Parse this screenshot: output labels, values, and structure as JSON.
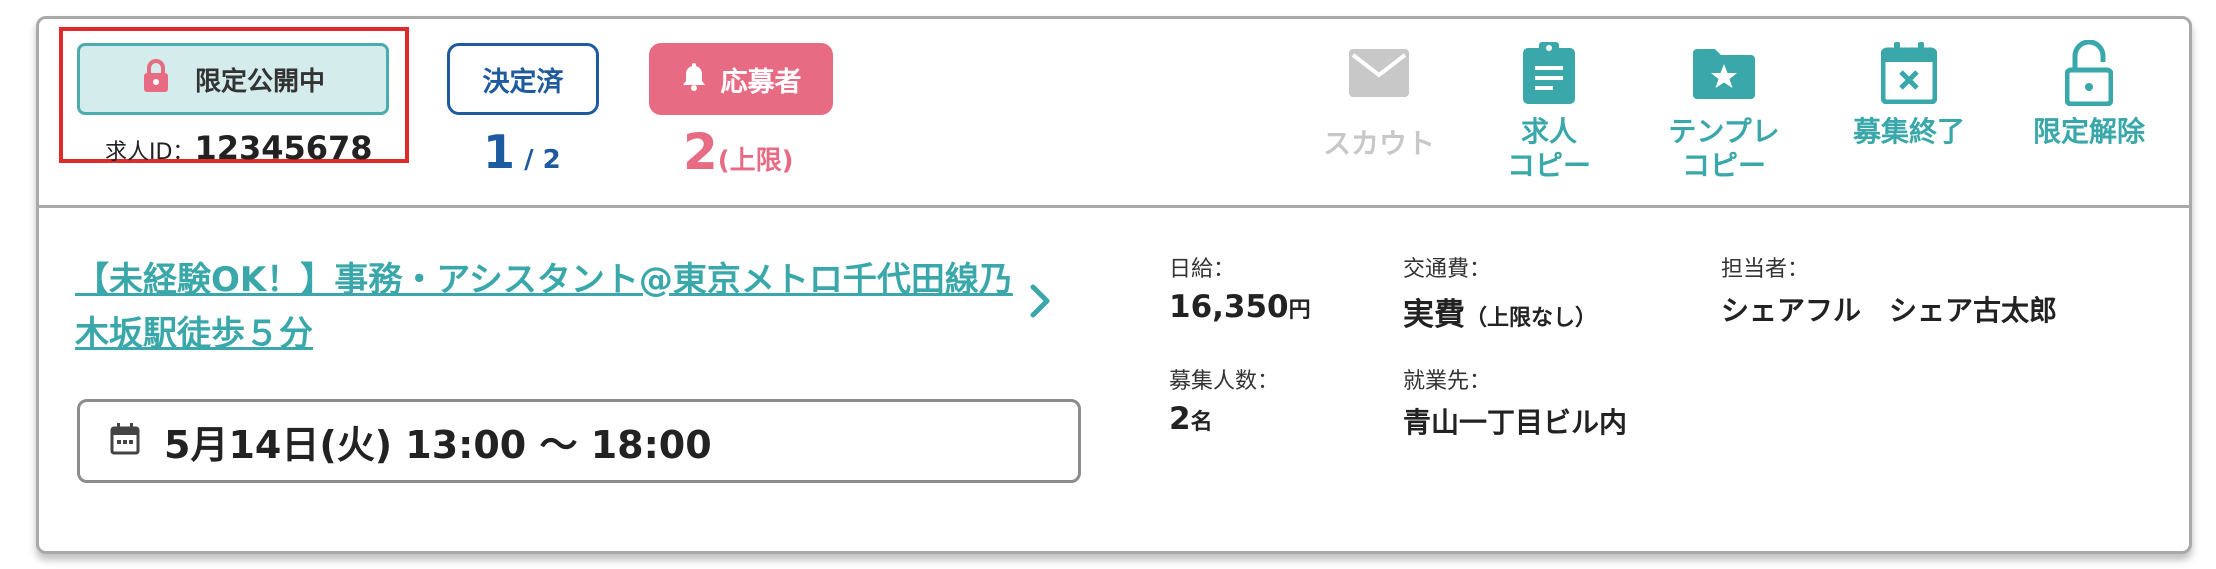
{
  "header": {
    "private_badge_label": "限定公開中",
    "job_id_label": "求人ID：",
    "job_id_value": "12345678",
    "decided_badge_label": "決定済",
    "decided_count": "1",
    "decided_total": " / 2",
    "applicant_badge_label": "応募者",
    "applicant_count": "2",
    "applicant_note": "(上限)",
    "actions": [
      {
        "label": "スカウト",
        "icon": "mail-icon",
        "state": "disabled"
      },
      {
        "label": "求人\nコピー",
        "icon": "clipboard-icon",
        "state": "active"
      },
      {
        "label": "テンプレ\nコピー",
        "icon": "folder-star-icon",
        "state": "active"
      },
      {
        "label": "募集終了",
        "icon": "calendar-x-icon",
        "state": "active"
      },
      {
        "label": "限定解除",
        "icon": "unlock-icon",
        "state": "active"
      }
    ]
  },
  "job": {
    "title": "【未経験OK！】事務・アシスタント@東京メトロ千代田線乃木坂駅徒歩５分",
    "schedule": "5月14日(火) 13:00 〜 18:00"
  },
  "details": {
    "daily_wage_label": "日給：",
    "daily_wage_value": "16,350",
    "daily_wage_unit": "円",
    "transport_label": "交通費：",
    "transport_value": "実費",
    "transport_note": "（上限なし）",
    "manager_label": "担当者：",
    "manager_value": "シェアフル　シェア古太郎",
    "recruit_count_label": "募集人数：",
    "recruit_count_value": "2",
    "recruit_count_unit": "名",
    "workplace_label": "就業先：",
    "workplace_value": "青山一丁目ビル内"
  },
  "colors": {
    "teal": "#3aa8aa",
    "navy": "#1e5a9e",
    "pink": "#e86b84",
    "highlight_red": "#dd2a2a",
    "disabled_gray": "#c8c8c8"
  }
}
